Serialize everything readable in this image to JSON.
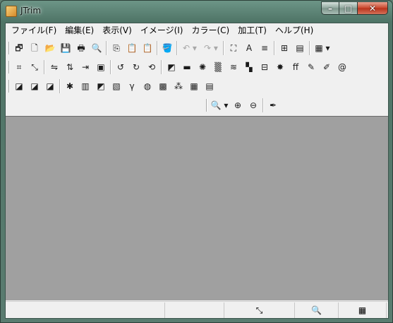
{
  "window": {
    "title": "JTrim",
    "caption_buttons": {
      "minimize": "–",
      "maximize": "□",
      "close": "✕"
    }
  },
  "menu": [
    "ファイル(F)",
    "編集(E)",
    "表示(V)",
    "イメージ(I)",
    "カラー(C)",
    "加工(T)",
    "ヘルプ(H)"
  ],
  "toolbars": {
    "row1": [
      {
        "name": "new-window-icon",
        "glyph": "🗗"
      },
      {
        "name": "new-file-icon",
        "glyph": "🗋"
      },
      {
        "name": "open-folder-icon",
        "glyph": "📂"
      },
      {
        "name": "save-icon",
        "glyph": "💾"
      },
      {
        "name": "print-icon",
        "glyph": "🖶"
      },
      {
        "name": "print-preview-icon",
        "glyph": "🔍"
      },
      {
        "sep": true
      },
      {
        "name": "copy-icon",
        "glyph": "⎘"
      },
      {
        "name": "paste-icon",
        "glyph": "📋"
      },
      {
        "name": "paste-new-icon",
        "glyph": "📋"
      },
      {
        "sep": true
      },
      {
        "name": "fill-bucket-icon",
        "glyph": "🪣"
      },
      {
        "sep": true
      },
      {
        "name": "undo-icon",
        "glyph": "↶ ▾",
        "disabled": true,
        "wide": true
      },
      {
        "name": "redo-icon",
        "glyph": "↷ ▾",
        "disabled": true,
        "wide": true
      },
      {
        "sep": true
      },
      {
        "name": "fit-window-icon",
        "glyph": "⛶"
      },
      {
        "name": "text-icon",
        "glyph": "A"
      },
      {
        "name": "align-icon",
        "glyph": "≡"
      },
      {
        "sep": true
      },
      {
        "name": "grid-icon",
        "glyph": "⊞"
      },
      {
        "name": "filmstrip-icon",
        "glyph": "▤"
      },
      {
        "sep": true
      },
      {
        "name": "color-palette-icon",
        "glyph": "▦ ▾",
        "wide": true
      }
    ],
    "row2": [
      {
        "name": "crop-icon",
        "glyph": "⌗"
      },
      {
        "name": "resize-icon",
        "glyph": "⤡"
      },
      {
        "sep": true
      },
      {
        "name": "flip-horizontal-icon",
        "glyph": "⇋"
      },
      {
        "name": "flip-vertical-icon",
        "glyph": "⇅"
      },
      {
        "name": "shrink-icon",
        "glyph": "⇥"
      },
      {
        "name": "frame-icon",
        "glyph": "▣"
      },
      {
        "sep": true
      },
      {
        "name": "rotate-left-90-icon",
        "glyph": "↺"
      },
      {
        "name": "rotate-right-90-icon",
        "glyph": "↻"
      },
      {
        "name": "rotate-free-icon",
        "glyph": "⟲"
      },
      {
        "sep": true
      },
      {
        "name": "shadow-icon",
        "glyph": "◩"
      },
      {
        "name": "emboss-icon",
        "glyph": "▬"
      },
      {
        "name": "blur-icon",
        "glyph": "✺"
      },
      {
        "name": "noise-icon",
        "glyph": "▒"
      },
      {
        "name": "wave-icon",
        "glyph": "≋"
      },
      {
        "name": "mosaic-icon",
        "glyph": "▚"
      },
      {
        "name": "brick-icon",
        "glyph": "⊟"
      },
      {
        "name": "sparkle-icon",
        "glyph": "✸"
      },
      {
        "name": "ff-icon",
        "glyph": "ff"
      },
      {
        "name": "pen-icon",
        "glyph": "✎"
      },
      {
        "name": "red-pen-icon",
        "glyph": "✐"
      },
      {
        "name": "spiral-icon",
        "glyph": "@"
      }
    ],
    "row3": [
      {
        "name": "gradient-gray-icon",
        "glyph": "◪"
      },
      {
        "name": "gradient-gold-icon",
        "glyph": "◪"
      },
      {
        "name": "gradient-blue-icon",
        "glyph": "◪"
      },
      {
        "sep": true
      },
      {
        "name": "auto-adjust-icon",
        "glyph": "✱"
      },
      {
        "name": "histogram-icon",
        "glyph": "▥"
      },
      {
        "name": "contrast-icon",
        "glyph": "◩"
      },
      {
        "name": "picture-icon",
        "glyph": "▧"
      },
      {
        "name": "gamma-icon",
        "glyph": "γ"
      },
      {
        "name": "color-wheel-icon",
        "glyph": "◍"
      },
      {
        "name": "checker-icon",
        "glyph": "▩"
      },
      {
        "name": "rgb-circles-icon",
        "glyph": "⁂"
      },
      {
        "name": "xor-icon",
        "glyph": "▦"
      },
      {
        "name": "grayscale-icon",
        "glyph": "▤"
      }
    ],
    "row4": [
      {
        "name": "zoom-icon",
        "glyph": "🔍 ▾",
        "wide": true
      },
      {
        "name": "zoom-in-icon",
        "glyph": "⊕"
      },
      {
        "name": "zoom-out-icon",
        "glyph": "⊖"
      },
      {
        "sep": true
      },
      {
        "name": "eyedropper-icon",
        "glyph": "✒"
      }
    ]
  },
  "statusbar": {
    "panes": [
      {
        "name": "status-pane-1",
        "glyph": ""
      },
      {
        "name": "status-pane-2",
        "glyph": ""
      },
      {
        "name": "status-resize-icon",
        "glyph": "⤡"
      },
      {
        "name": "status-zoom-icon",
        "glyph": "🔍"
      },
      {
        "name": "status-color-icon",
        "glyph": "▦"
      }
    ]
  },
  "colors": {
    "titlebar": "#4f7466",
    "canvas": "#a0a0a0",
    "client": "#f0f0f0"
  }
}
